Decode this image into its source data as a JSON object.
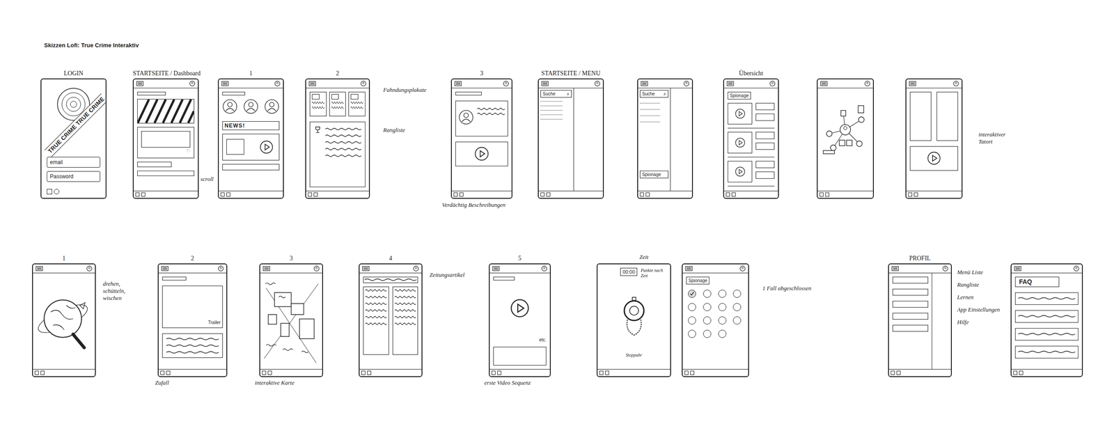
{
  "title": "Skizzen Lofi: True Crime Interaktiv",
  "rows": [
    {
      "sketches": [
        {
          "kind": "login",
          "heading": "LOGIN",
          "texts": [
            "TRUE CRIME TRUE CRIME",
            "email",
            "Password"
          ],
          "annotations": []
        },
        {
          "kind": "dashboard",
          "heading": "STARTSEITE / Dashboard",
          "texts": [],
          "annotations": [
            "scroll"
          ]
        },
        {
          "kind": "friends",
          "heading": "1",
          "texts": [
            "NEWS!"
          ],
          "annotations": []
        },
        {
          "kind": "wanted",
          "heading": "2",
          "texts": [],
          "annotations": [
            "Fahndungsplakate",
            "Rangliste"
          ]
        },
        {
          "kind": "suspect",
          "heading": "3",
          "texts": [],
          "annotations": [
            "Verdächtig Beschreibungen"
          ]
        },
        {
          "kind": "menu",
          "heading": "STARTSEITE / MENU",
          "texts": [
            "Suche"
          ],
          "annotations": []
        },
        {
          "kind": "search",
          "texts": [
            "Suche",
            "Spionage"
          ],
          "annotations": []
        },
        {
          "kind": "overview",
          "heading": "Übersicht",
          "texts": [
            "Spionage"
          ],
          "annotations": []
        },
        {
          "kind": "network",
          "texts": [],
          "annotations": []
        },
        {
          "kind": "crime-scene",
          "texts": [],
          "annotations": [
            "interaktiver Tatort"
          ]
        }
      ]
    },
    {
      "sketches": [
        {
          "kind": "globe",
          "heading": "1",
          "texts": [],
          "annotations": [
            "drehen, schütteln, wischen"
          ]
        },
        {
          "kind": "trailer",
          "heading": "2",
          "texts": [
            "Trailer"
          ],
          "annotations": [
            "Zufall"
          ]
        },
        {
          "kind": "map",
          "heading": "3",
          "texts": [],
          "annotations": [
            "interaktive Karte"
          ]
        },
        {
          "kind": "newspaper",
          "heading": "4",
          "texts": [],
          "annotations": [
            "Zeitungsartikel"
          ]
        },
        {
          "kind": "video",
          "heading": "5",
          "texts": [
            "etc."
          ],
          "annotations": [
            "erste Video Sequenz"
          ]
        },
        {
          "kind": "stopwatch",
          "texts": [
            "00:00",
            "Punkte nach Zeit",
            "Stoppuhr"
          ],
          "annotations": [
            "Zeit"
          ]
        },
        {
          "kind": "cases",
          "texts": [
            "Spionage"
          ],
          "annotations": [
            "1 Fall abgeschlossen"
          ],
          "cases": [
            {
              "done": true
            },
            {
              "done": false
            },
            {
              "done": false
            },
            {
              "done": false
            },
            {
              "done": false
            },
            {
              "done": false
            },
            {
              "done": false
            },
            {
              "done": false
            },
            {
              "done": false
            },
            {
              "done": false
            },
            {
              "done": false
            },
            {
              "done": false
            },
            {
              "done": false
            },
            {
              "done": false
            },
            {
              "done": false
            }
          ]
        },
        {
          "kind": "profile",
          "heading": "PROFIL",
          "texts": [],
          "annotations": [
            "Menü Liste",
            "Rangliste",
            "Lernen",
            "App Einstellungen",
            "Hilfe"
          ]
        },
        {
          "kind": "faq",
          "texts": [
            "FAQ"
          ],
          "annotations": []
        }
      ]
    }
  ]
}
